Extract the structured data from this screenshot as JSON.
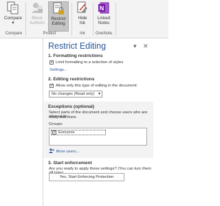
{
  "ribbon": {
    "compare": {
      "label": "Compare"
    },
    "block_authors": {
      "label1": "Block",
      "label2": "Authors"
    },
    "restrict_editing": {
      "label1": "Restrict",
      "label2": "Editing"
    },
    "hide_ink": {
      "label1": "Hide",
      "label2": "Ink"
    },
    "linked_notes": {
      "label1": "Linked",
      "label2": "Notes"
    },
    "groups": {
      "compare": "Compare",
      "protect": "Protect",
      "ink": "Ink",
      "onenote": "OneNote"
    }
  },
  "pane": {
    "title": "Restrict Editing",
    "controls": {
      "dropdown": "▾",
      "close": "✕"
    },
    "formatting": {
      "heading": "1. Formatting restrictions",
      "checkbox_label": "Limit formatting to a selection of styles",
      "settings_link": "Settings..."
    },
    "editing": {
      "heading": "2. Editing restrictions",
      "checkbox_label": "Allow only this type of editing in the document:",
      "selected": "No changes (Read only)"
    },
    "exceptions": {
      "heading": "Exceptions (optional)",
      "description_line1": "Select parts of the document and choose users who are allowed to",
      "description_line2": "freely edit them.",
      "groups_label": "Groups:",
      "groups": [
        "Everyone"
      ],
      "more_users": "More users..."
    },
    "enforcement": {
      "heading": "3. Start enforcement",
      "question": "Are you ready to apply these settings? (You can turn them off later)",
      "button": "Yes, Start Enforcing Protection"
    }
  },
  "colors": {
    "accent": "#2b579a",
    "onenote": "#7719aa",
    "ribbon": "#f3f3f3"
  }
}
